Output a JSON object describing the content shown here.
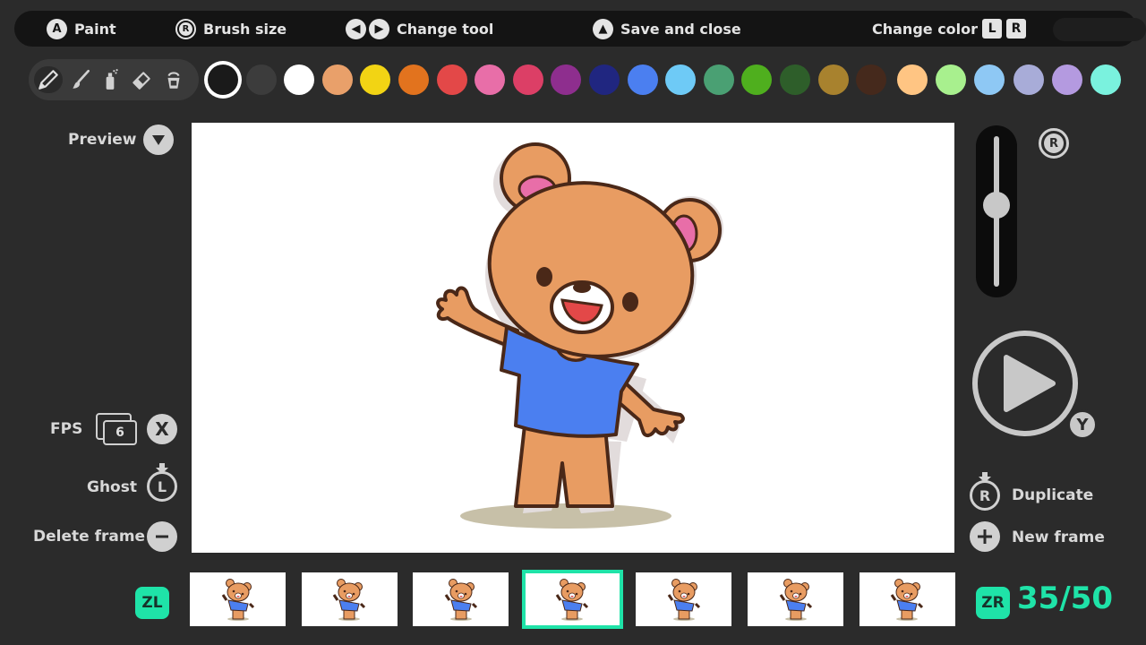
{
  "hints": {
    "paint": {
      "button": "A",
      "label": "Paint"
    },
    "brush_size": {
      "button": "R",
      "label": "Brush size"
    },
    "change_tool": {
      "label": "Change tool"
    },
    "save_close": {
      "label": "Save and close"
    },
    "change_color": {
      "label": "Change color",
      "key_l": "L",
      "key_r": "R"
    }
  },
  "tools": [
    "pencil-icon",
    "brush-icon",
    "spray-icon",
    "eraser-icon",
    "bucket-icon"
  ],
  "palette": [
    "#1a1a1a",
    "#3c3c3c",
    "#ffffff",
    "#e9a06a",
    "#f2d414",
    "#e2731e",
    "#e34848",
    "#e86ea8",
    "#dc3f66",
    "#8e2e8e",
    "#202680",
    "#4b7ff0",
    "#6ecaf6",
    "#4aa073",
    "#4faf1e",
    "#2e5e2a",
    "#a8822e",
    "#45291c",
    "#ffc583",
    "#a8f08e",
    "#8ec8f4",
    "#a8acd8",
    "#b49ae0",
    "#7af2de"
  ],
  "left_panel": {
    "preview": {
      "label": "Preview"
    },
    "fps": {
      "label": "FPS",
      "value": "6",
      "button": "X"
    },
    "ghost": {
      "label": "Ghost",
      "button": "L"
    },
    "delete_frame": {
      "label": "Delete frame"
    }
  },
  "right_panel": {
    "size_slider_button": "R",
    "size_level": 0.55,
    "play_button": "Y",
    "duplicate": {
      "label": "Duplicate",
      "button": "R"
    },
    "new_frame": {
      "label": "New frame"
    }
  },
  "timeline": {
    "zl": "ZL",
    "zr": "ZR",
    "counter": "35/50",
    "frame_count": 7,
    "current_index": 3
  },
  "colors": {
    "accent": "#1fe3a8",
    "background": "#2b2b2b",
    "bar": "#141414"
  }
}
